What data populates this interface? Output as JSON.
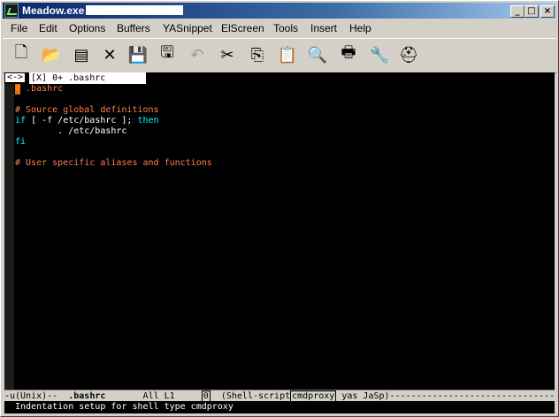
{
  "window": {
    "title": "Meadow.exe"
  },
  "controls": {
    "minimize": "_",
    "maximize": "□",
    "close": "×"
  },
  "menu": [
    "File",
    "Edit",
    "Options",
    "Buffers",
    "YASnippet",
    "ElScreen",
    "Tools",
    "Insert",
    "Help"
  ],
  "toolbar": [
    {
      "name": "new-file-icon",
      "glyph": "🗋",
      "enabled": true
    },
    {
      "name": "open-folder-icon",
      "glyph": "📂",
      "enabled": true
    },
    {
      "name": "dired-icon",
      "glyph": "▤",
      "enabled": true
    },
    {
      "name": "close-buffer-icon",
      "glyph": "✕",
      "enabled": true
    },
    {
      "name": "save-icon",
      "glyph": "💾",
      "enabled": false
    },
    {
      "name": "save-as-icon",
      "glyph": "🖫",
      "enabled": true
    },
    {
      "name": "undo-icon",
      "glyph": "↶",
      "enabled": false
    },
    {
      "name": "cut-icon",
      "glyph": "✂",
      "enabled": true
    },
    {
      "name": "copy-icon",
      "glyph": "⎘",
      "enabled": true
    },
    {
      "name": "paste-icon",
      "glyph": "📋",
      "enabled": true
    },
    {
      "name": "search-icon",
      "glyph": "🔍",
      "enabled": true
    },
    {
      "name": "print-icon",
      "glyph": "🖶",
      "enabled": true
    },
    {
      "name": "customize-icon",
      "glyph": "🔧",
      "enabled": true
    },
    {
      "name": "help-icon",
      "glyph": "⛑",
      "enabled": true
    }
  ],
  "tabline": {
    "arrows": "<->",
    "current": "[X] 0+ .bashrc"
  },
  "editor": {
    "lines": [
      [
        {
          "t": "# .bashrc",
          "c": "comment"
        }
      ],
      [],
      [
        {
          "t": "# Source global definitions",
          "c": "comment"
        }
      ],
      [
        {
          "t": "if",
          "c": "kw"
        },
        {
          "t": " [ -f /etc/bashrc ]; ",
          "c": "text"
        },
        {
          "t": "then",
          "c": "kw"
        }
      ],
      [
        {
          "t": "        . /etc/bashrc",
          "c": "text"
        }
      ],
      [
        {
          "t": "fi",
          "c": "kw"
        }
      ],
      [],
      [
        {
          "t": "# User specific aliases and functions",
          "c": "comment"
        }
      ]
    ]
  },
  "modeline": {
    "prefix": "-u(Unix)--  ",
    "buffer": ".bashrc",
    "position": "       All L1     ",
    "screen": "0",
    "mode_start": "  (Shell-script",
    "minor": "cmdproxy",
    "mode_end": " yas JaSp)",
    "fill": "--------------------------------------------"
  },
  "echo_area": "Indentation setup for shell type cmdproxy"
}
